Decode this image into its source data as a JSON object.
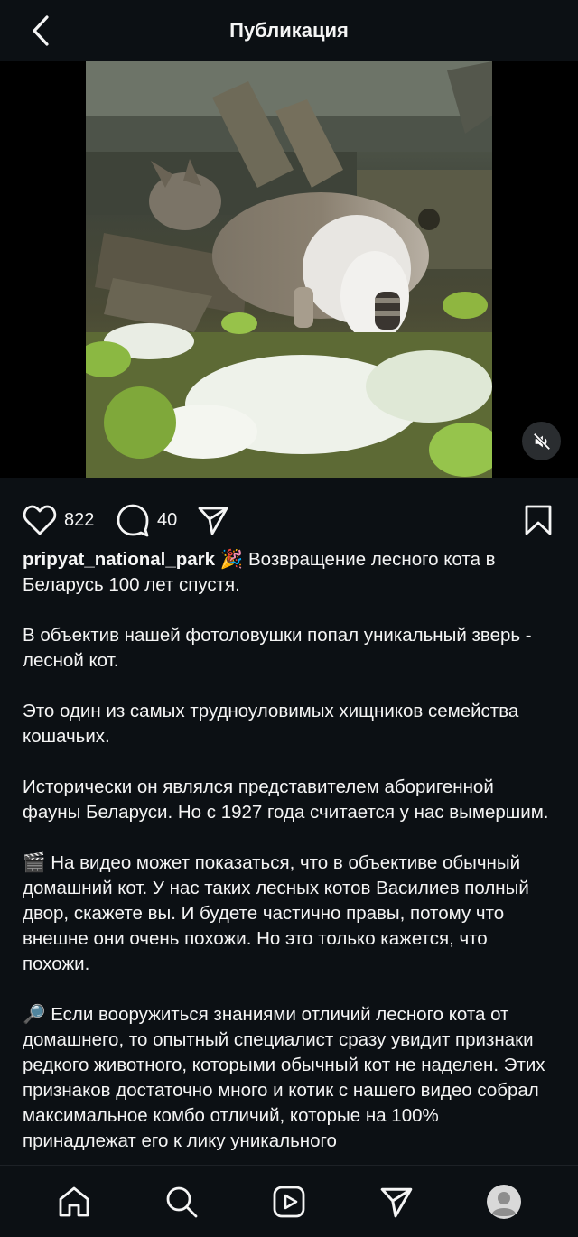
{
  "header": {
    "title": "Публикация",
    "back_icon": "chevron-left-icon"
  },
  "media": {
    "type": "video",
    "mute_icon": "muted-speaker-icon"
  },
  "actions": {
    "likes": "822",
    "comments": "40",
    "icons": [
      "heart-icon",
      "comment-icon",
      "share-icon",
      "bookmark-icon"
    ]
  },
  "post": {
    "username": "pripyat_national_park",
    "paragraphs": [
      "🎉 Возвращение лесного кота в Беларусь 100 лет спустя.",
      "В объектив нашей фотоловушки попал уникальный зверь - лесной кот.",
      "Это один из самых трудноуловимых хищников семейства кошачьих.",
      "Исторически он являлся представителем аборигенной фауны Беларуси. Но с 1927 года считается у нас вымершим.",
      "🎬 На видео может показаться, что в объективе обычный домашний кот. У нас таких лесных котов Василиев полный двор, скажете вы. И будете частично правы, потому что внешне они очень похожи. Но это только кажется, что похожи.",
      "🔎 Если вооружиться знаниями отличий лесного кота от домашнего, то опытный специалист сразу увидит признаки редкого животного, которыми обычный кот не наделен. Этих признаков достаточно много и котик с нашего видео собрал максимальное комбо отличий, которые на 100% принадлежат его к лику уникального"
    ]
  },
  "bottom_nav": [
    "home-icon",
    "search-icon",
    "reels-icon",
    "direct-icon",
    "profile-avatar"
  ],
  "colors": {
    "background": "#0c1014",
    "text": "#f5f5f5"
  }
}
